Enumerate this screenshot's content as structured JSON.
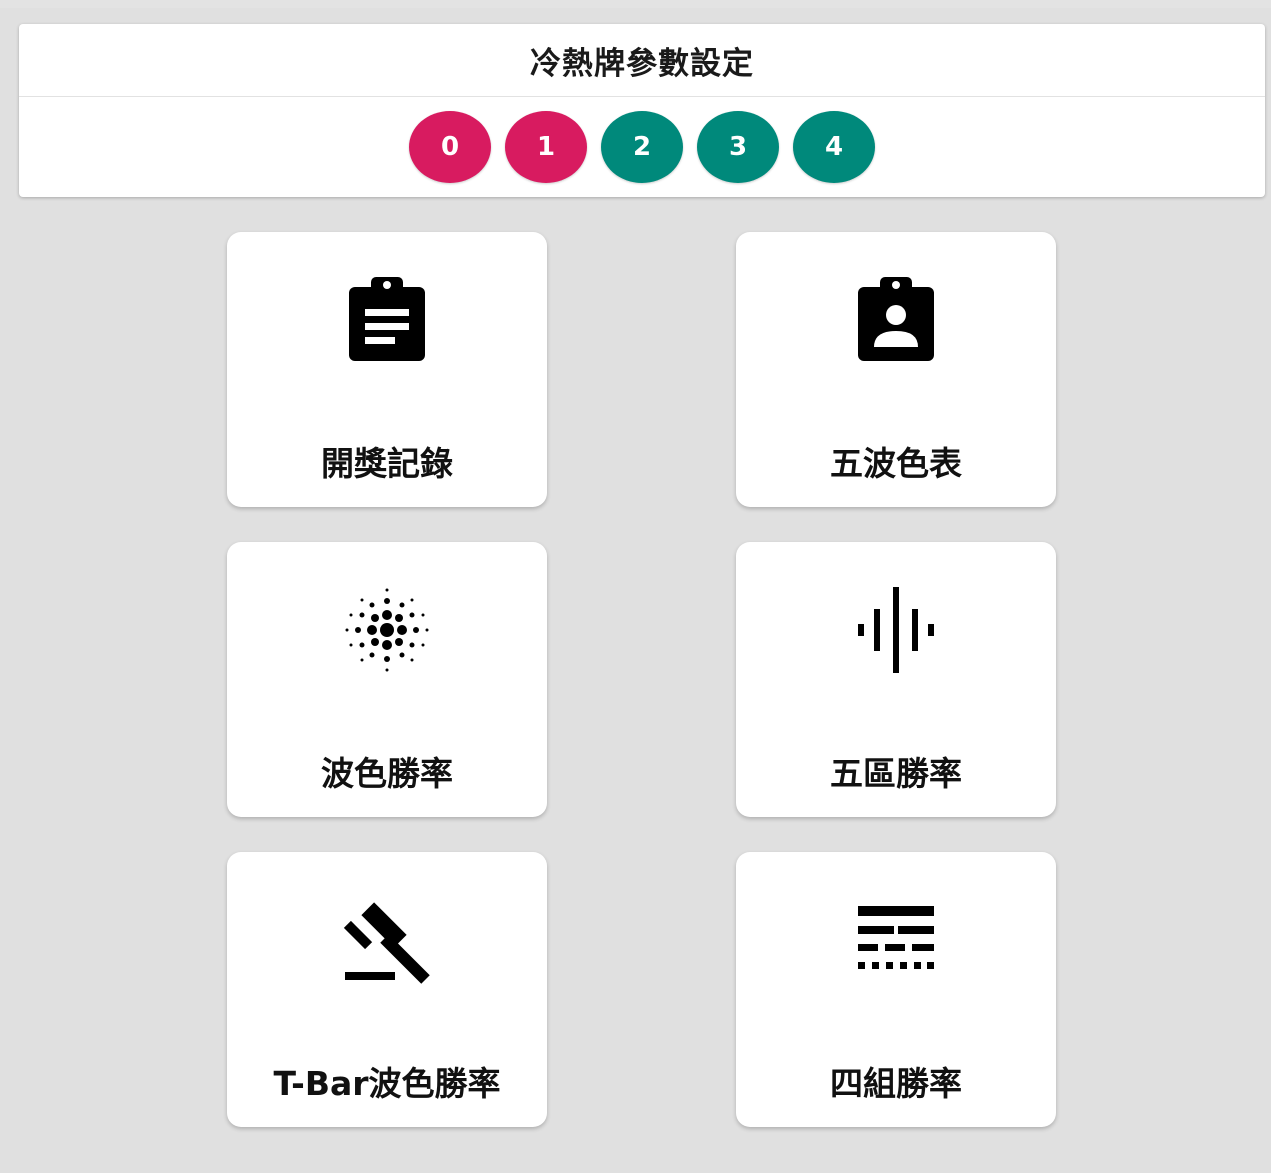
{
  "header": {
    "title": "冷熱牌參數設定",
    "balls": [
      {
        "label": "0",
        "color": "#d81b60"
      },
      {
        "label": "1",
        "color": "#d81b60"
      },
      {
        "label": "2",
        "color": "#00897b"
      },
      {
        "label": "3",
        "color": "#00897b"
      },
      {
        "label": "4",
        "color": "#00897b"
      }
    ]
  },
  "menu": {
    "tiles": [
      {
        "label": "開獎記錄",
        "icon": "clipboard-list-icon"
      },
      {
        "label": "五波色表",
        "icon": "clipboard-account-icon"
      },
      {
        "label": "波色勝率",
        "icon": "dotted-grain-icon"
      },
      {
        "label": "五區勝率",
        "icon": "graphic-eq-icon"
      },
      {
        "label": "T-Bar波色勝率",
        "icon": "gavel-icon"
      },
      {
        "label": "四組勝率",
        "icon": "line-style-icon"
      }
    ]
  }
}
